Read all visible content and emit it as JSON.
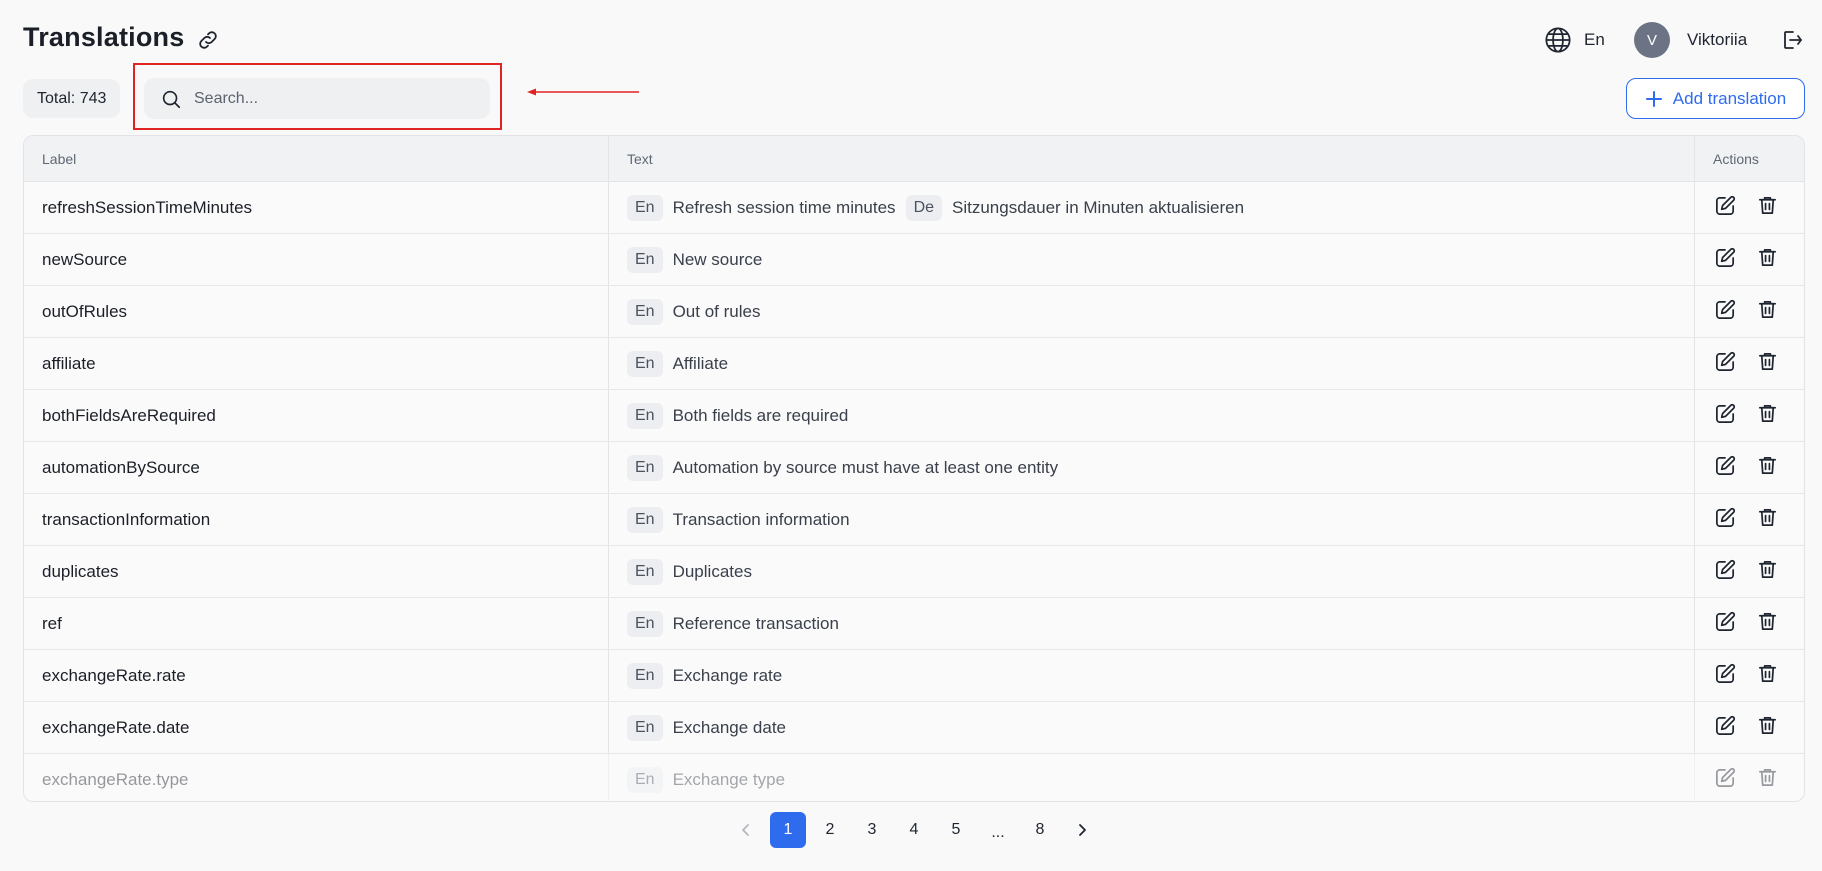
{
  "header": {
    "title": "Translations",
    "language": "En",
    "user": {
      "initial": "V",
      "name": "Viktoriia"
    }
  },
  "toolbar": {
    "total_label": "Total: 743",
    "search_placeholder": "Search...",
    "add_label": "Add translation"
  },
  "table": {
    "columns": [
      "Label",
      "Text",
      "Actions"
    ],
    "rows": [
      {
        "label": "refreshSessionTimeMinutes",
        "texts": [
          {
            "lang": "En",
            "text": "Refresh session time minutes"
          },
          {
            "lang": "De",
            "text": "Sitzungsdauer in Minuten aktualisieren"
          }
        ]
      },
      {
        "label": "newSource",
        "texts": [
          {
            "lang": "En",
            "text": "New source"
          }
        ]
      },
      {
        "label": "outOfRules",
        "texts": [
          {
            "lang": "En",
            "text": "Out of rules"
          }
        ]
      },
      {
        "label": "affiliate",
        "texts": [
          {
            "lang": "En",
            "text": "Affiliate"
          }
        ]
      },
      {
        "label": "bothFieldsAreRequired",
        "texts": [
          {
            "lang": "En",
            "text": "Both fields are required"
          }
        ]
      },
      {
        "label": "automationBySource",
        "texts": [
          {
            "lang": "En",
            "text": "Automation by source must have at least one entity"
          }
        ]
      },
      {
        "label": "transactionInformation",
        "texts": [
          {
            "lang": "En",
            "text": "Transaction information"
          }
        ]
      },
      {
        "label": "duplicates",
        "texts": [
          {
            "lang": "En",
            "text": "Duplicates"
          }
        ]
      },
      {
        "label": "ref",
        "texts": [
          {
            "lang": "En",
            "text": "Reference transaction"
          }
        ]
      },
      {
        "label": "exchangeRate.rate",
        "texts": [
          {
            "lang": "En",
            "text": "Exchange rate"
          }
        ]
      },
      {
        "label": "exchangeRate.date",
        "texts": [
          {
            "lang": "En",
            "text": "Exchange date"
          }
        ]
      },
      {
        "label": "exchangeRate.type",
        "texts": [
          {
            "lang": "En",
            "text": "Exchange type"
          }
        ]
      }
    ]
  },
  "pagination": {
    "pages": [
      "1",
      "2",
      "3",
      "4",
      "5",
      "...",
      "8"
    ],
    "current": "1"
  },
  "colors": {
    "accent": "#2f6bed",
    "highlight": "#e02424",
    "avatar": "#6b7384"
  }
}
